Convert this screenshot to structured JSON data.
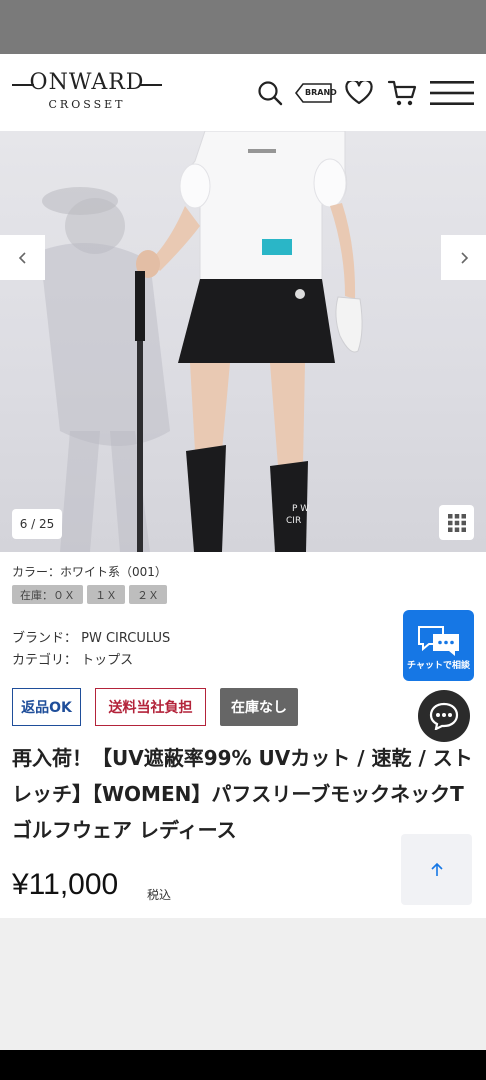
{
  "header": {
    "logo_main": "ONWARD",
    "logo_sub": "CROSSET",
    "brand_label": "BRAND",
    "icons": [
      "search-icon",
      "brand-tag-icon",
      "heart-icon",
      "cart-icon",
      "menu-icon"
    ]
  },
  "gallery": {
    "counter": "6 / 25",
    "current": 6,
    "total": 25
  },
  "product": {
    "color_label": "カラー：ホワイト系（001）",
    "sizes": [
      "在庫：０Ｘ",
      "１Ｘ",
      "２Ｘ"
    ],
    "brand_line": "ブランド：  PW CIRCULUS",
    "category_line": "カテゴリ：  トップス",
    "badges": {
      "returnable": "返品OK",
      "shipping": "送料当社負担",
      "stock": "在庫なし"
    },
    "title": "再入荷！【UV遮蔽率99% UVカット / 速乾 / ストレッチ】【WOMEN】パフスリーブモックネックT ゴルフウェア レディース",
    "price": "¥11,000",
    "tax_label": "税込"
  },
  "chat": {
    "label": "チャットで相談"
  },
  "colors": {
    "accent_blue": "#1677e5",
    "returnable": "#1f4e9a",
    "shipping": "#b3233a",
    "stock_bg": "#666666"
  }
}
